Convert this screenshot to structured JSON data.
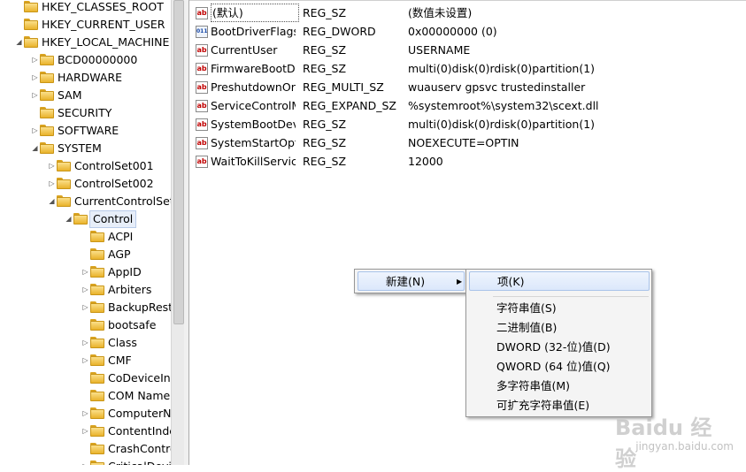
{
  "tree": {
    "items": [
      {
        "label": "HKEY_CLASSES_ROOT",
        "depth": 0,
        "expander": ""
      },
      {
        "label": "HKEY_CURRENT_USER",
        "depth": 0,
        "expander": ""
      },
      {
        "label": "HKEY_LOCAL_MACHINE",
        "depth": 0,
        "expander": "expanded"
      },
      {
        "label": "BCD00000000",
        "depth": 1,
        "expander": "collapsed"
      },
      {
        "label": "HARDWARE",
        "depth": 1,
        "expander": "collapsed"
      },
      {
        "label": "SAM",
        "depth": 1,
        "expander": "collapsed"
      },
      {
        "label": "SECURITY",
        "depth": 1,
        "expander": ""
      },
      {
        "label": "SOFTWARE",
        "depth": 1,
        "expander": "collapsed"
      },
      {
        "label": "SYSTEM",
        "depth": 1,
        "expander": "expanded"
      },
      {
        "label": "ControlSet001",
        "depth": 2,
        "expander": "collapsed"
      },
      {
        "label": "ControlSet002",
        "depth": 2,
        "expander": "collapsed"
      },
      {
        "label": "CurrentControlSet",
        "depth": 2,
        "expander": "expanded"
      },
      {
        "label": "Control",
        "depth": 3,
        "expander": "expanded",
        "selected": true
      },
      {
        "label": "ACPI",
        "depth": 4,
        "expander": ""
      },
      {
        "label": "AGP",
        "depth": 4,
        "expander": ""
      },
      {
        "label": "AppID",
        "depth": 4,
        "expander": "collapsed"
      },
      {
        "label": "Arbiters",
        "depth": 4,
        "expander": "collapsed"
      },
      {
        "label": "BackupRestore",
        "depth": 4,
        "expander": "collapsed"
      },
      {
        "label": "bootsafe",
        "depth": 4,
        "expander": ""
      },
      {
        "label": "Class",
        "depth": 4,
        "expander": "collapsed"
      },
      {
        "label": "CMF",
        "depth": 4,
        "expander": "collapsed"
      },
      {
        "label": "CoDeviceInsta",
        "depth": 4,
        "expander": ""
      },
      {
        "label": "COM Name Ar",
        "depth": 4,
        "expander": ""
      },
      {
        "label": "ComputerNam",
        "depth": 4,
        "expander": "collapsed"
      },
      {
        "label": "ContentIndex",
        "depth": 4,
        "expander": "collapsed"
      },
      {
        "label": "CrashControl",
        "depth": 4,
        "expander": ""
      },
      {
        "label": "CriticalDeviceD",
        "depth": 4,
        "expander": "collapsed"
      }
    ]
  },
  "values": {
    "rows": [
      {
        "icon": "string-value-icon",
        "name": "(默认)",
        "type": "REG_SZ",
        "data": "(数值未设置)",
        "selected": true
      },
      {
        "icon": "binary-value-icon",
        "name": "BootDriverFlags",
        "type": "REG_DWORD",
        "data": "0x00000000 (0)"
      },
      {
        "icon": "string-value-icon",
        "name": "CurrentUser",
        "type": "REG_SZ",
        "data": "USERNAME"
      },
      {
        "icon": "string-value-icon",
        "name": "FirmwareBootDevice",
        "type": "REG_SZ",
        "data": "multi(0)disk(0)rdisk(0)partition(1)"
      },
      {
        "icon": "string-value-icon",
        "name": "PreshutdownOrder",
        "type": "REG_MULTI_SZ",
        "data": "wuauserv gpsvc trustedinstaller"
      },
      {
        "icon": "string-value-icon",
        "name": "ServiceControlManagerExtension",
        "type": "REG_EXPAND_SZ",
        "data": "%systemroot%\\system32\\scext.dll"
      },
      {
        "icon": "string-value-icon",
        "name": "SystemBootDevice",
        "type": "REG_SZ",
        "data": "multi(0)disk(0)rdisk(0)partition(1)"
      },
      {
        "icon": "string-value-icon",
        "name": "SystemStartOptions",
        "type": "REG_SZ",
        "data": " NOEXECUTE=OPTIN"
      },
      {
        "icon": "string-value-icon",
        "name": "WaitToKillServiceTimeout",
        "type": "REG_SZ",
        "data": "12000"
      }
    ]
  },
  "context_menu": {
    "new_label": "新建(N)"
  },
  "submenu": {
    "key_label": "项(K)",
    "items": [
      "字符串值(S)",
      "二进制值(B)",
      "DWORD (32-位)值(D)",
      "QWORD (64 位)值(Q)",
      "多字符串值(M)",
      "可扩充字符串值(E)"
    ]
  },
  "watermark": {
    "brand": "Baidu 经验",
    "url": "jingyan.baidu.com"
  },
  "colors": {
    "folder": "#e9b32b",
    "menu_highlight": "#dce8fb",
    "string_icon": "#c00000",
    "binary_icon": "#1a4aa8"
  }
}
